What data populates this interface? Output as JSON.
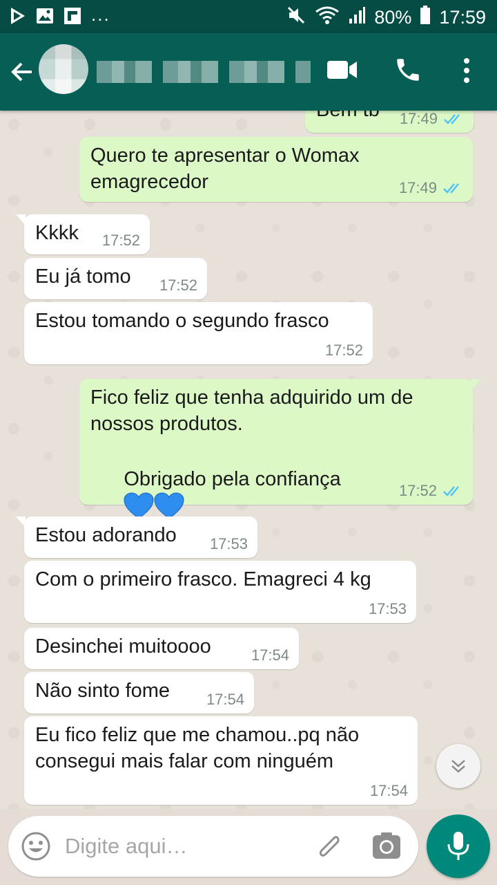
{
  "status_bar": {
    "overflow": "...",
    "battery": "80%",
    "time": "17:59",
    "icons": [
      "play-store-icon",
      "gallery-icon",
      "flipboard-icon",
      "mute-icon",
      "wifi-icon",
      "signal-icon",
      "battery-icon"
    ]
  },
  "toolbar": {
    "icons": [
      "back-arrow-icon",
      "video-call-icon",
      "phone-icon",
      "more-vert-icon"
    ]
  },
  "messages": [
    {
      "dir": "out",
      "text": "Bem tb",
      "time": "17:49",
      "status": "read"
    },
    {
      "dir": "out",
      "text": "Quero te apresentar o Womax\nemagrecedor",
      "time": "17:49",
      "status": "read"
    },
    {
      "dir": "in",
      "text": "Kkkk",
      "time": "17:52"
    },
    {
      "dir": "in",
      "text": "Eu já tomo",
      "time": "17:52"
    },
    {
      "dir": "in",
      "text": "Estou tomando o segundo frasco",
      "time": "17:52"
    },
    {
      "dir": "out",
      "text": "Fico feliz que tenha adquirido um de\nnossos produtos.",
      "text2": "Obrigado pela confiança",
      "emoji": "blue-heart-icon x2",
      "time": "17:52",
      "status": "read"
    },
    {
      "dir": "in",
      "text": "Estou adorando",
      "time": "17:53"
    },
    {
      "dir": "in",
      "text": "Com o primeiro frasco. Emagreci 4 kg",
      "time": "17:53"
    },
    {
      "dir": "in",
      "text": "Desinchei muitoooo",
      "time": "17:54"
    },
    {
      "dir": "in",
      "text": "Não sinto fome",
      "time": "17:54"
    },
    {
      "dir": "in",
      "text": "Eu fico feliz que me chamou..pq não\nconsegui mais falar com ninguém",
      "time": "17:54"
    }
  ],
  "input": {
    "placeholder": "Digite aqui…",
    "value": ""
  },
  "colors": {
    "status_bar": "#054c44",
    "toolbar": "#075e54",
    "outgoing_bubble": "#dcf8c6",
    "incoming_bubble": "#ffffff",
    "read_ticks": "#4fc3f7",
    "mic_button": "#00897b"
  }
}
